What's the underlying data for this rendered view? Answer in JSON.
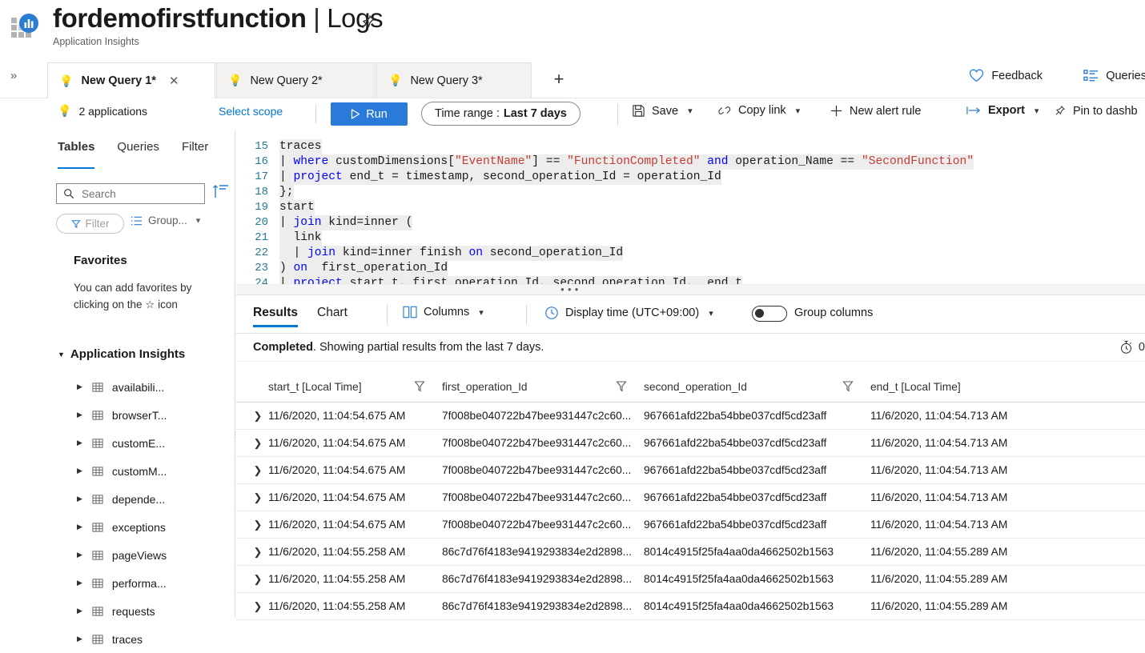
{
  "header": {
    "title_main": "fordemofirstfunction",
    "title_sep": "|",
    "title_section": "Logs",
    "subtitle": "Application Insights",
    "logo_icon": "application-insights-icon",
    "pin_icon": "pin-icon"
  },
  "tabs": {
    "collapse_icon": "double-chevron-right-icon",
    "items": [
      {
        "label": "New Query 1*",
        "icon": "lightbulb-icon",
        "active": true,
        "close_icon": "close-icon"
      },
      {
        "label": "New Query 2*",
        "icon": "lightbulb-icon",
        "active": false
      },
      {
        "label": "New Query 3*",
        "icon": "lightbulb-icon",
        "active": false
      }
    ],
    "add_label": "+",
    "feedback_label": "Feedback",
    "feedback_icon": "heart-icon",
    "queries_label": "Queries",
    "queries_icon": "list-icon"
  },
  "commandbar": {
    "scope_label": "2 applications",
    "scope_icon": "lightbulb-icon",
    "select_scope_label": "Select scope",
    "run_label": "Run",
    "run_icon": "play-icon",
    "run_color": "#2a7ad9",
    "time_range_prefix": "Time range :",
    "time_range_value": "Last 7 days",
    "save_label": "Save",
    "save_icon": "save-icon",
    "copy_link_label": "Copy link",
    "copy_link_icon": "link-icon",
    "new_alert_label": "New alert rule",
    "new_alert_icon": "plus-icon",
    "export_label": "Export",
    "export_icon": "export-icon",
    "pin_label": "Pin to dashb",
    "pin_icon": "pin-icon"
  },
  "leftpanel": {
    "tabs": [
      {
        "label": "Tables",
        "active": true
      },
      {
        "label": "Queries",
        "active": false
      },
      {
        "label": "Filter",
        "active": false
      }
    ],
    "search_placeholder": "Search",
    "search_value": "",
    "search_icon": "search-icon",
    "sort_icon": "sort-icon",
    "filter_label": "Filter",
    "filter_icon": "funnel-icon",
    "group_label": "Group...",
    "group_icon": "group-list-icon",
    "favorites_title": "Favorites",
    "favorites_hint": "You can add favorites by clicking on the ☆ icon",
    "group_header": "Application Insights",
    "tables": [
      {
        "label": "availabili...",
        "icon": "table-icon"
      },
      {
        "label": "browserT...",
        "icon": "table-icon"
      },
      {
        "label": "customE...",
        "icon": "table-icon"
      },
      {
        "label": "customM...",
        "icon": "table-icon"
      },
      {
        "label": "depende...",
        "icon": "table-icon"
      },
      {
        "label": "exceptions",
        "icon": "table-icon"
      },
      {
        "label": "pageViews",
        "icon": "table-icon"
      },
      {
        "label": "performa...",
        "icon": "table-icon"
      },
      {
        "label": "requests",
        "icon": "table-icon"
      },
      {
        "label": "traces",
        "icon": "table-icon"
      }
    ]
  },
  "editor": {
    "lines": [
      {
        "num": "15",
        "text": "traces",
        "clipped": true
      },
      {
        "num": "16",
        "text": "| where customDimensions[\"EventName\"] == \"FunctionCompleted\" and operation_Name == \"SecondFunction\""
      },
      {
        "num": "17",
        "text": "| project end_t = timestamp, second_operation_Id = operation_Id"
      },
      {
        "num": "18",
        "text": "};"
      },
      {
        "num": "19",
        "text": "start"
      },
      {
        "num": "20",
        "text": "| join kind=inner ("
      },
      {
        "num": "21",
        "text": "  link"
      },
      {
        "num": "22",
        "text": "  | join kind=inner finish on second_operation_Id"
      },
      {
        "num": "23",
        "text": ") on  first_operation_Id"
      },
      {
        "num": "24",
        "text": "| project start_t, first_operation_Id, second_operation_Id,  end_t"
      },
      {
        "num": "25",
        "text": ""
      }
    ]
  },
  "results": {
    "tabs": [
      {
        "label": "Results",
        "active": true
      },
      {
        "label": "Chart",
        "active": false
      }
    ],
    "columns_label": "Columns",
    "columns_icon": "columns-icon",
    "display_time_label": "Display time (UTC+09:00)",
    "display_time_icon": "clock-icon",
    "group_columns_label": "Group columns",
    "group_columns_on": false,
    "status_bold": "Completed",
    "status_rest": ". Showing partial results from the last 7 days.",
    "timer_icon": "stopwatch-icon",
    "timer_text": "0",
    "table": {
      "headers": [
        {
          "label": "start_t [Local Time]",
          "filter_icon": "funnel-icon"
        },
        {
          "label": "first_operation_Id",
          "filter_icon": "funnel-icon"
        },
        {
          "label": "second_operation_Id",
          "filter_icon": "funnel-icon"
        },
        {
          "label": "end_t [Local Time]",
          "filter_icon": null
        }
      ],
      "expander_icon": "chevron-right-icon",
      "rows": [
        [
          "11/6/2020, 11:04:54.675 AM",
          "7f008be040722b47bee931447c2c60...",
          "967661afd22ba54bbe037cdf5cd23aff",
          "11/6/2020, 11:04:54.713 AM"
        ],
        [
          "11/6/2020, 11:04:54.675 AM",
          "7f008be040722b47bee931447c2c60...",
          "967661afd22ba54bbe037cdf5cd23aff",
          "11/6/2020, 11:04:54.713 AM"
        ],
        [
          "11/6/2020, 11:04:54.675 AM",
          "7f008be040722b47bee931447c2c60...",
          "967661afd22ba54bbe037cdf5cd23aff",
          "11/6/2020, 11:04:54.713 AM"
        ],
        [
          "11/6/2020, 11:04:54.675 AM",
          "7f008be040722b47bee931447c2c60...",
          "967661afd22ba54bbe037cdf5cd23aff",
          "11/6/2020, 11:04:54.713 AM"
        ],
        [
          "11/6/2020, 11:04:54.675 AM",
          "7f008be040722b47bee931447c2c60...",
          "967661afd22ba54bbe037cdf5cd23aff",
          "11/6/2020, 11:04:54.713 AM"
        ],
        [
          "11/6/2020, 11:04:55.258 AM",
          "86c7d76f4183e9419293834e2d2898...",
          "8014c4915f25fa4aa0da4662502b1563",
          "11/6/2020, 11:04:55.289 AM"
        ],
        [
          "11/6/2020, 11:04:55.258 AM",
          "86c7d76f4183e9419293834e2d2898...",
          "8014c4915f25fa4aa0da4662502b1563",
          "11/6/2020, 11:04:55.289 AM"
        ],
        [
          "11/6/2020, 11:04:55.258 AM",
          "86c7d76f4183e9419293834e2d2898...",
          "8014c4915f25fa4aa0da4662502b1563",
          "11/6/2020, 11:04:55.289 AM"
        ]
      ]
    }
  }
}
